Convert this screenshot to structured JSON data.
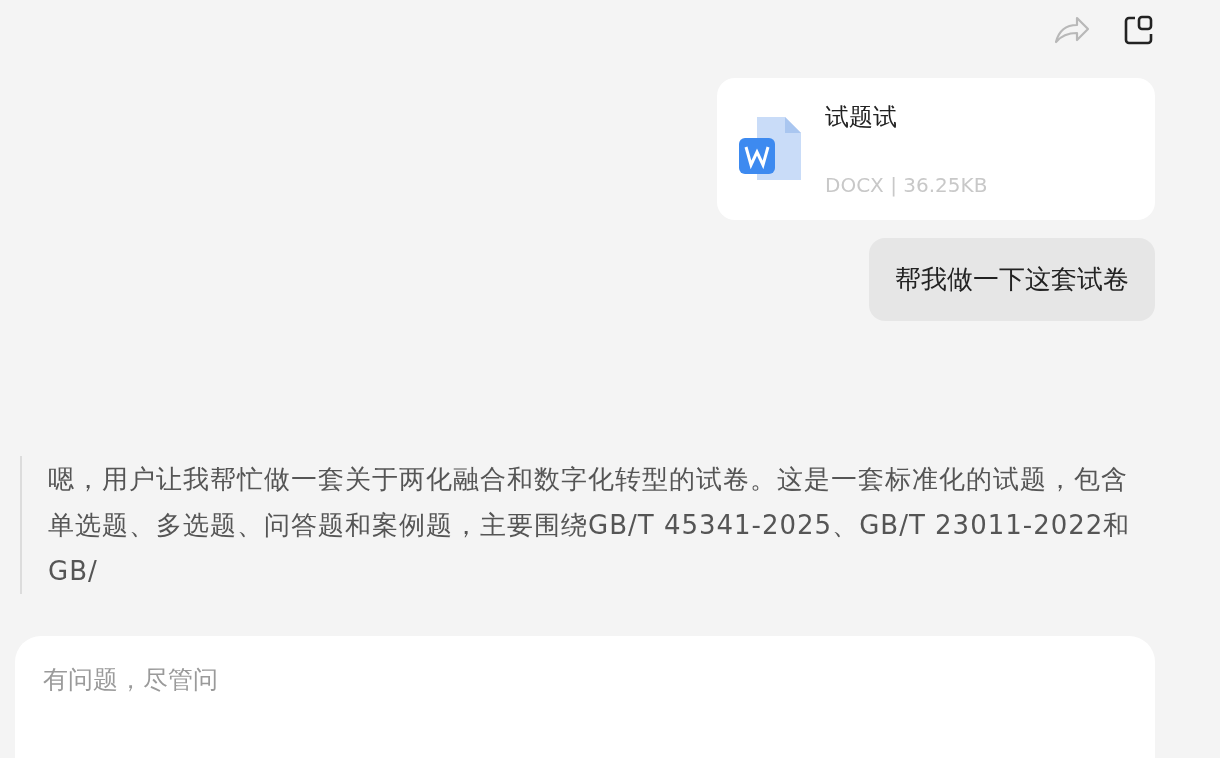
{
  "file_card": {
    "name": "试题试",
    "meta": "DOCX | 36.25KB"
  },
  "user_message": "帮我做一下这套试卷",
  "thinking": "嗯，用户让我帮忙做一套关于两化融合和数字化转型的试卷。这是一套标准化的试题，包含单选题、多选题、问答题和案例题，主要围绕GB/T 45341-2025、GB/T 23011-2022和GB/",
  "input": {
    "placeholder": "有问题，尽管问"
  }
}
